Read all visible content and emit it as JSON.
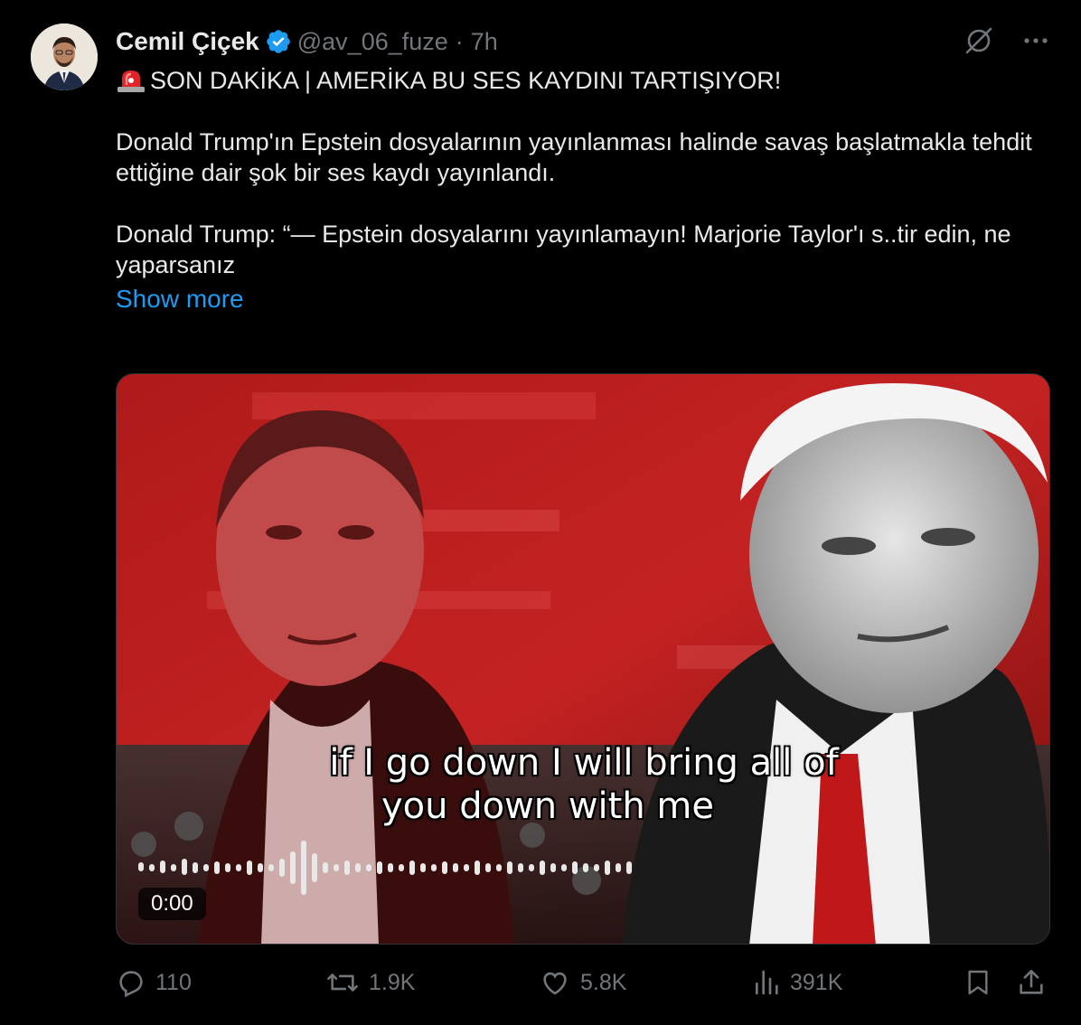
{
  "author": {
    "name": "Cemil Çiçek",
    "handle": "@av_06_fuze",
    "separator": "·",
    "time": "7h"
  },
  "tweet": {
    "headline": "SON DAKİKA | AMERİKA BU SES KAYDINI TARTIŞIYOR!",
    "paragraph1": "Donald Trump'ın Epstein dosyalarının yayınlanması halinde savaş başlatmakla tehdit ettiğine dair şok bir ses kaydı yayınlandı.",
    "paragraph2": "Donald Trump: “— Epstein dosyalarını yayınlamayın! Marjorie Taylor'ı s..tir edin, ne yaparsanız",
    "show_more": "Show more"
  },
  "video": {
    "caption_line1": "if I go down I will bring all of",
    "caption_line2": "you down with me",
    "timecode": "0:00"
  },
  "actions": {
    "replies": "110",
    "reposts": "1.9K",
    "likes": "5.8K",
    "views": "391K"
  },
  "colors": {
    "background": "#000000",
    "text": "#e7e9ea",
    "muted": "#71767b",
    "link": "#1d9bf0",
    "verified": "#1d9bf0"
  },
  "icons": [
    "siren-emoji",
    "verified-badge-icon",
    "grok-icon",
    "more-icon",
    "reply-icon",
    "repost-icon",
    "like-icon",
    "views-icon",
    "bookmark-icon",
    "share-icon"
  ]
}
